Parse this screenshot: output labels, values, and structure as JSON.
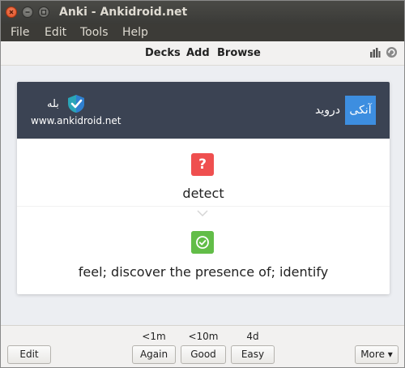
{
  "window": {
    "title": "Anki - Ankidroid.net"
  },
  "menu": {
    "items": [
      {
        "label": "File"
      },
      {
        "label": "Edit"
      },
      {
        "label": "Tools"
      },
      {
        "label": "Help"
      }
    ]
  },
  "toolbar": {
    "decks": "Decks",
    "add": "Add",
    "browse": "Browse",
    "stats_icon": "bar-chart-icon",
    "sync_icon": "sync-icon"
  },
  "card": {
    "header": {
      "yes_text": "بله",
      "brand_url": "www.ankidroid.net",
      "tag": "آنکی",
      "sponsor": "دروید",
      "header_color": "#3b4353",
      "tag_color": "#3d8ee0"
    },
    "question_icon": "?",
    "front": "detect",
    "back": "feel; discover the presence of; identify",
    "question_color": "#ef4f4f",
    "answer_color": "#62bd48"
  },
  "bottombar": {
    "edit": "Edit",
    "more": "More ▾",
    "answers": [
      {
        "time": "<1m",
        "label": "Again"
      },
      {
        "time": "<10m",
        "label": "Good"
      },
      {
        "time": "4d",
        "label": "Easy"
      }
    ]
  }
}
